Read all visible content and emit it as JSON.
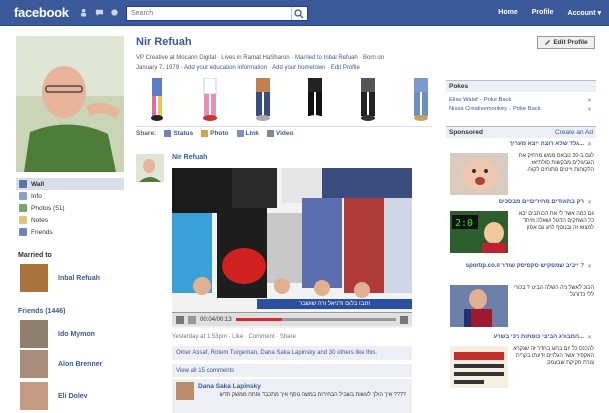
{
  "topbar": {
    "logo": "facebook",
    "search_placeholder": "Search",
    "nav": [
      "Home",
      "Profile",
      "Account ▾"
    ]
  },
  "profile": {
    "name": "Nir Refuah",
    "edit_button": "Edit Profile",
    "info_line1": "VP Creative at Mocann Digital",
    "info_line2": "Lives in Ramat HaSharon",
    "info_line3": "Married to Inbal Refuah",
    "info_line4": "Born on",
    "info_line5": "January 7, 1979",
    "info_add_edu": "Add your education information",
    "info_add_home": "Add your hometown",
    "info_edit": "Edit Profile"
  },
  "leftnav": {
    "items": [
      "Wall",
      "Info",
      "Photos (51)",
      "Notes",
      "Friends"
    ]
  },
  "relationship": {
    "title": "Married to",
    "name": "Inbal Refuah"
  },
  "friends": {
    "title": "Friends (1446)",
    "list": [
      "Ido Mymon",
      "Alon Brenner",
      "Eli Dolev"
    ]
  },
  "share": {
    "label": "Share:",
    "items": [
      "Status",
      "Photo",
      "Link",
      "Video"
    ]
  },
  "post": {
    "author": "Nir Refuah",
    "video_time": "00:04/00:13",
    "video_progress": 0.29,
    "video_caption": "וזנבו  בלום  ודניאל  ורה  שושבר",
    "meta": "Yesterday at 1:53pm · Like · Comment · Share",
    "likes": "Omer Assaf, Rotem Turgeman, Dana Saka Lapinsky and 30 others like this.",
    "view_all": "View all 15 comments",
    "comment_author": "Dana Saka Lapinsky",
    "comment_text": "???? איך הולך לעשות בשביל הבחירות במשה נוסף איך מתכבד ופתח ממשק חדש"
  },
  "pokes": {
    "title": "Pokes",
    "rows": [
      {
        "name": "Eliav Walaf",
        "action": "Poke Back"
      },
      {
        "name": "Nissa Creativemonkey",
        "action": "Poke Back"
      }
    ]
  },
  "sponsored": {
    "title": "Sponsored",
    "create": "Create an Ad",
    "ads": [
      {
        "title": "...גלד שלא רוצה ייצא מעריך",
        "body": "לגם ב-20 נובאס ממש מרחיק את הגבעולים מבקשות סולתיאז. הלקוחות וייטים פתוחים לקוח."
      },
      {
        "title": "רק בתאודים מחיריםיים מבסכים",
        "body": "גם כמה אשר לי את הכותבים יבא כל השחקים הדגול ושאלה מיחד למצוא זה ובנוסף לחג גם אסון"
      },
      {
        "title": "? ייביב שמפקיש סקסיסק שודר sportip.co.il",
        "body": "הכוכ לאשל ניה השלה הבינו ? בכורי ללי כדורגל"
      },
      {
        "title": "...המבורג הביצי כופתות רכי בשרע",
        "body": "להכנס כל יום בחוג בחדר זה שנקרא האקפיר אשר הגלויים ודעתו בקרית צורת חקיקת שבעמק"
      }
    ]
  },
  "colors": {
    "brand": "#3b5998",
    "brand_dark": "#29447e",
    "video_progress": "#e1262c"
  }
}
